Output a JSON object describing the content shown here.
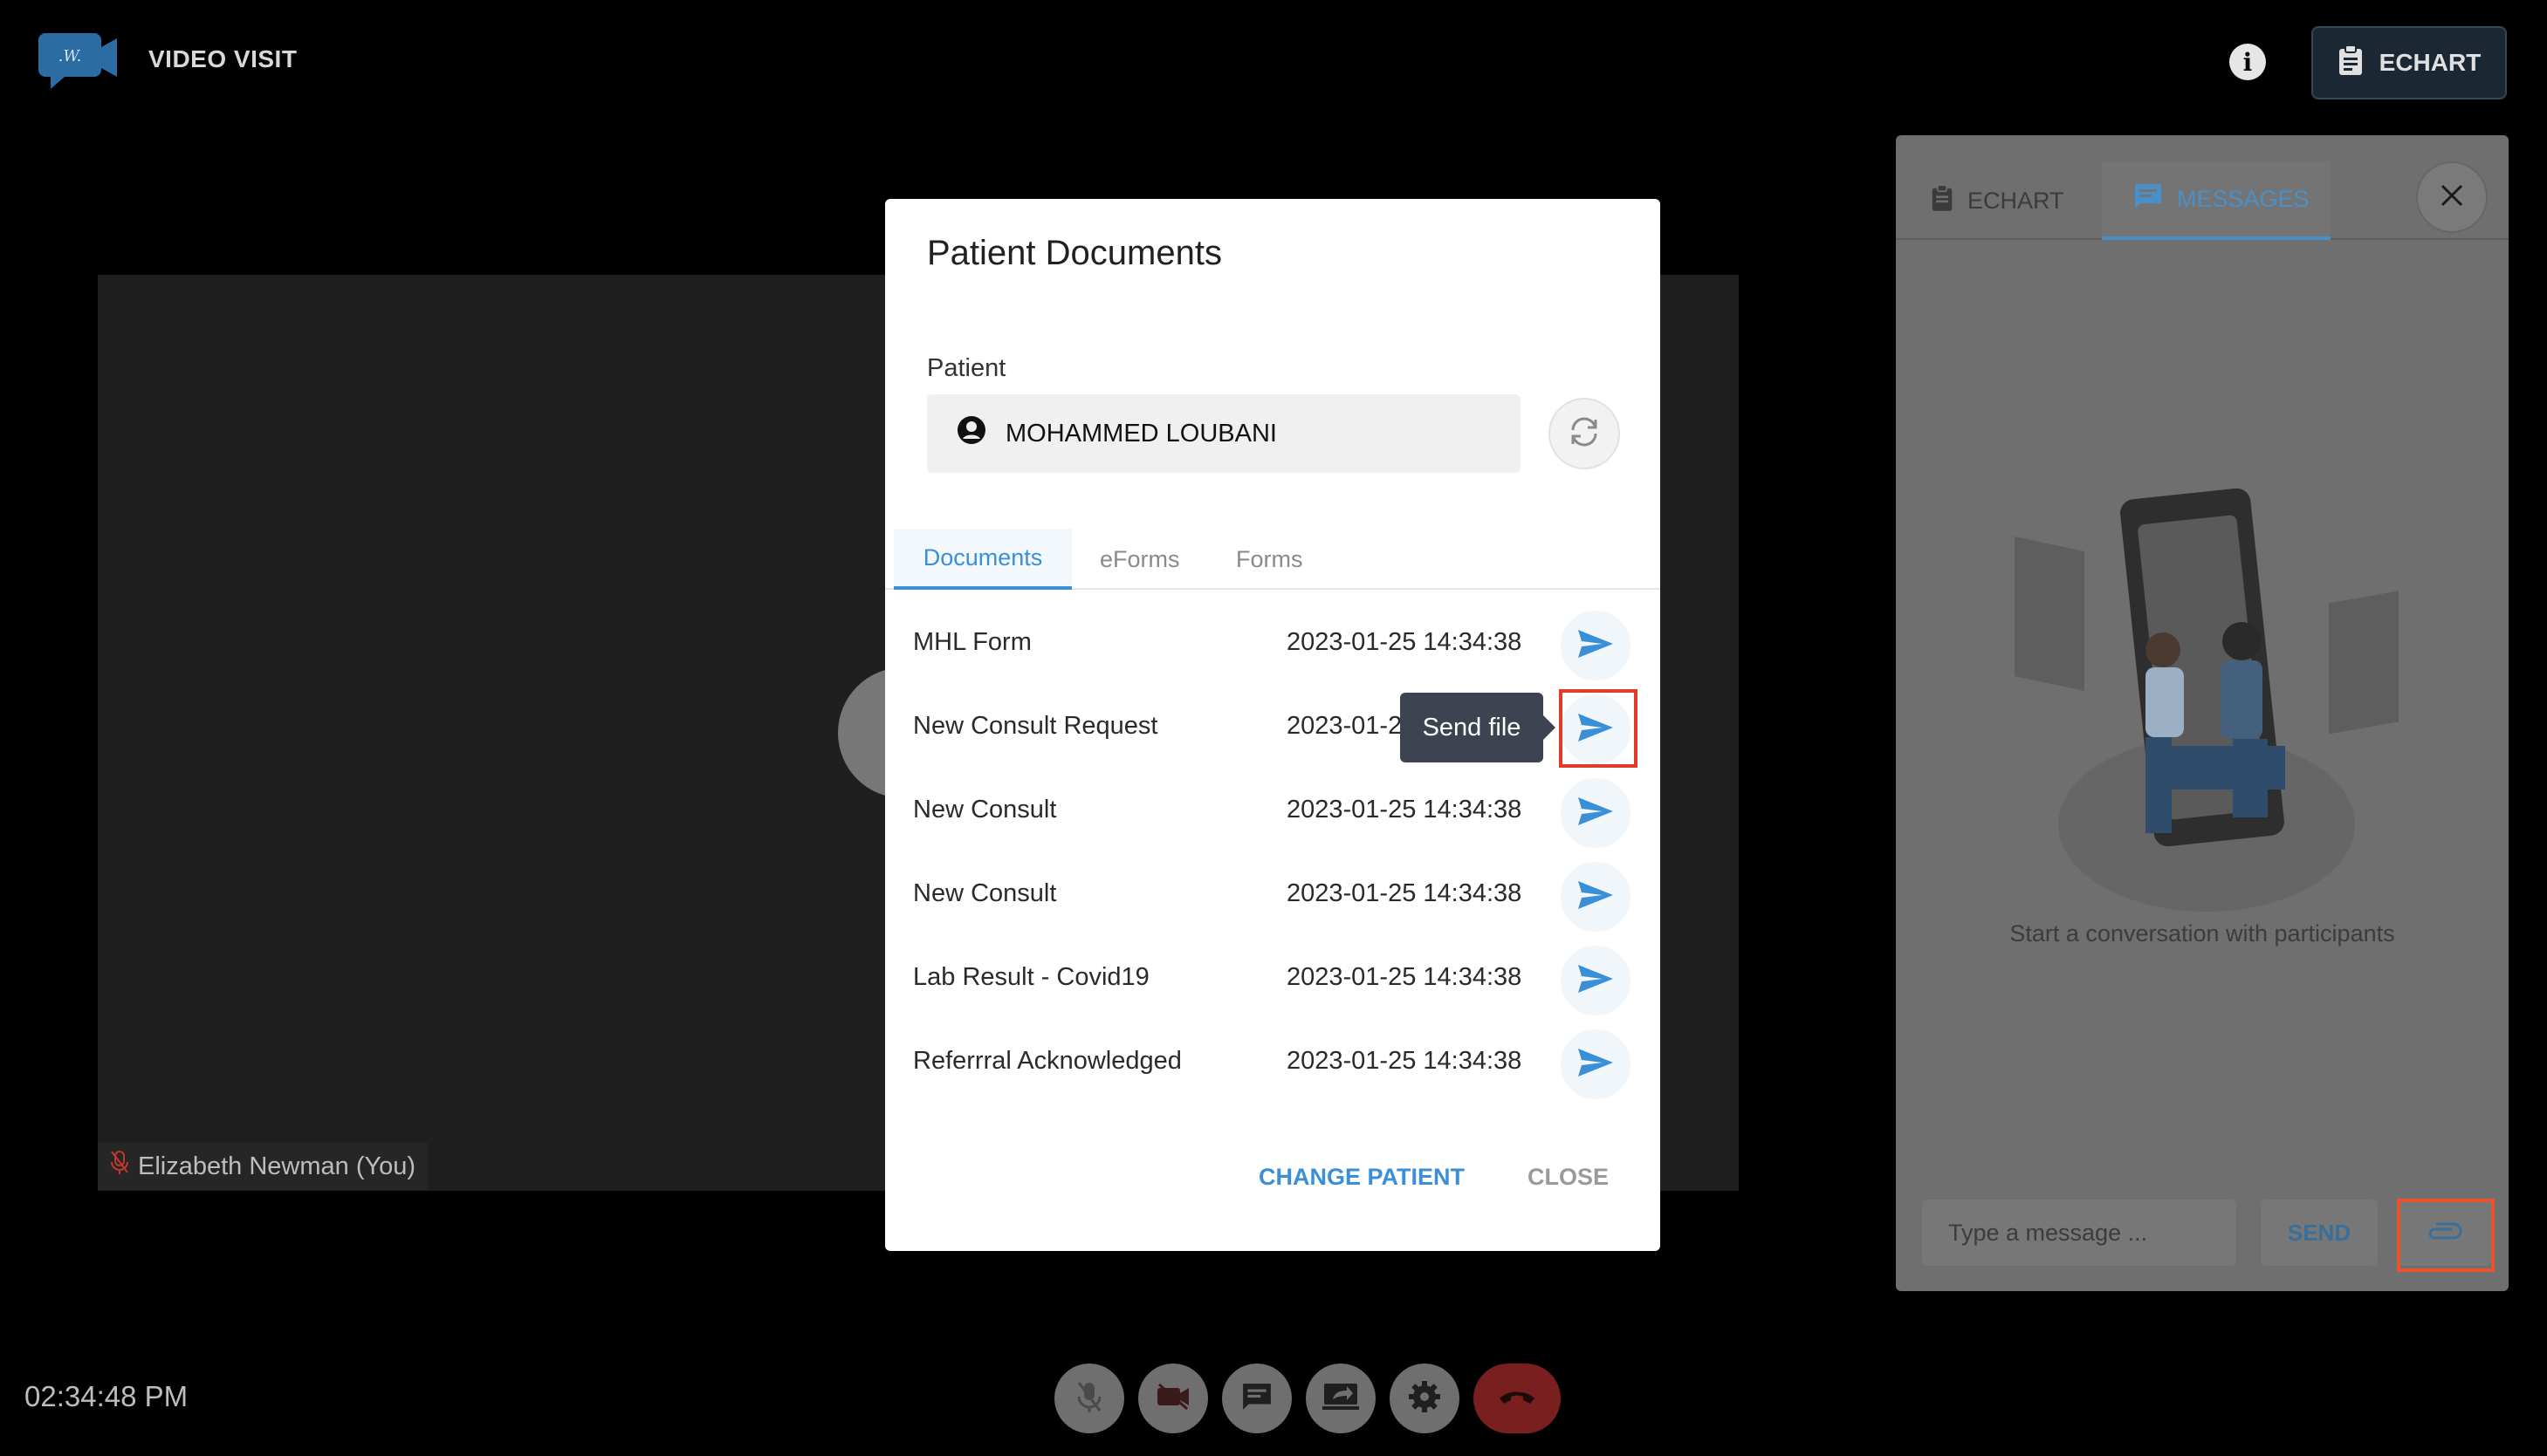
{
  "app": {
    "title": "VIDEO VISIT",
    "echart_label": "ECHART"
  },
  "video": {
    "self_label": "Elizabeth Newman (You)"
  },
  "clock": "02:34:48 PM",
  "side_panel": {
    "tabs": [
      {
        "label": "ECHART"
      },
      {
        "label": "MESSAGES"
      }
    ],
    "active_tab": "MESSAGES",
    "empty_text": "Start a conversation with participants",
    "input_placeholder": "Type a message ...",
    "send_label": "SEND"
  },
  "modal": {
    "title": "Patient Documents",
    "patient_label": "Patient",
    "patient_name": "MOHAMMED LOUBANI",
    "tabs": [
      {
        "label": "Documents"
      },
      {
        "label": "eForms"
      },
      {
        "label": "Forms"
      }
    ],
    "active_tab": "Documents",
    "documents": [
      {
        "name": "MHL Form",
        "date": "2023-01-25 14:34:38"
      },
      {
        "name": "New Consult Request",
        "date": "2023-01-2"
      },
      {
        "name": "New Consult",
        "date": "2023-01-25 14:34:38"
      },
      {
        "name": "New Consult",
        "date": "2023-01-25 14:34:38"
      },
      {
        "name": "Lab Result - Covid19",
        "date": "2023-01-25 14:34:38"
      },
      {
        "name": "Referrral Acknowledged",
        "date": "2023-01-25 14:34:38"
      }
    ],
    "tooltip": "Send file",
    "change_patient_label": "CHANGE PATIENT",
    "close_label": "CLOSE"
  },
  "colors": {
    "accent": "#3a8fd6",
    "end_call": "#7a1f1f",
    "highlight": "#e23b2a"
  },
  "icons": {
    "logo": "video-camera-logo-icon",
    "info": "info-icon",
    "clipboard": "clipboard-icon",
    "chat": "chat-icon",
    "close": "close-icon",
    "attach": "paperclip-icon",
    "send": "send-icon",
    "refresh": "refresh-icon",
    "account": "account-circle-icon"
  }
}
